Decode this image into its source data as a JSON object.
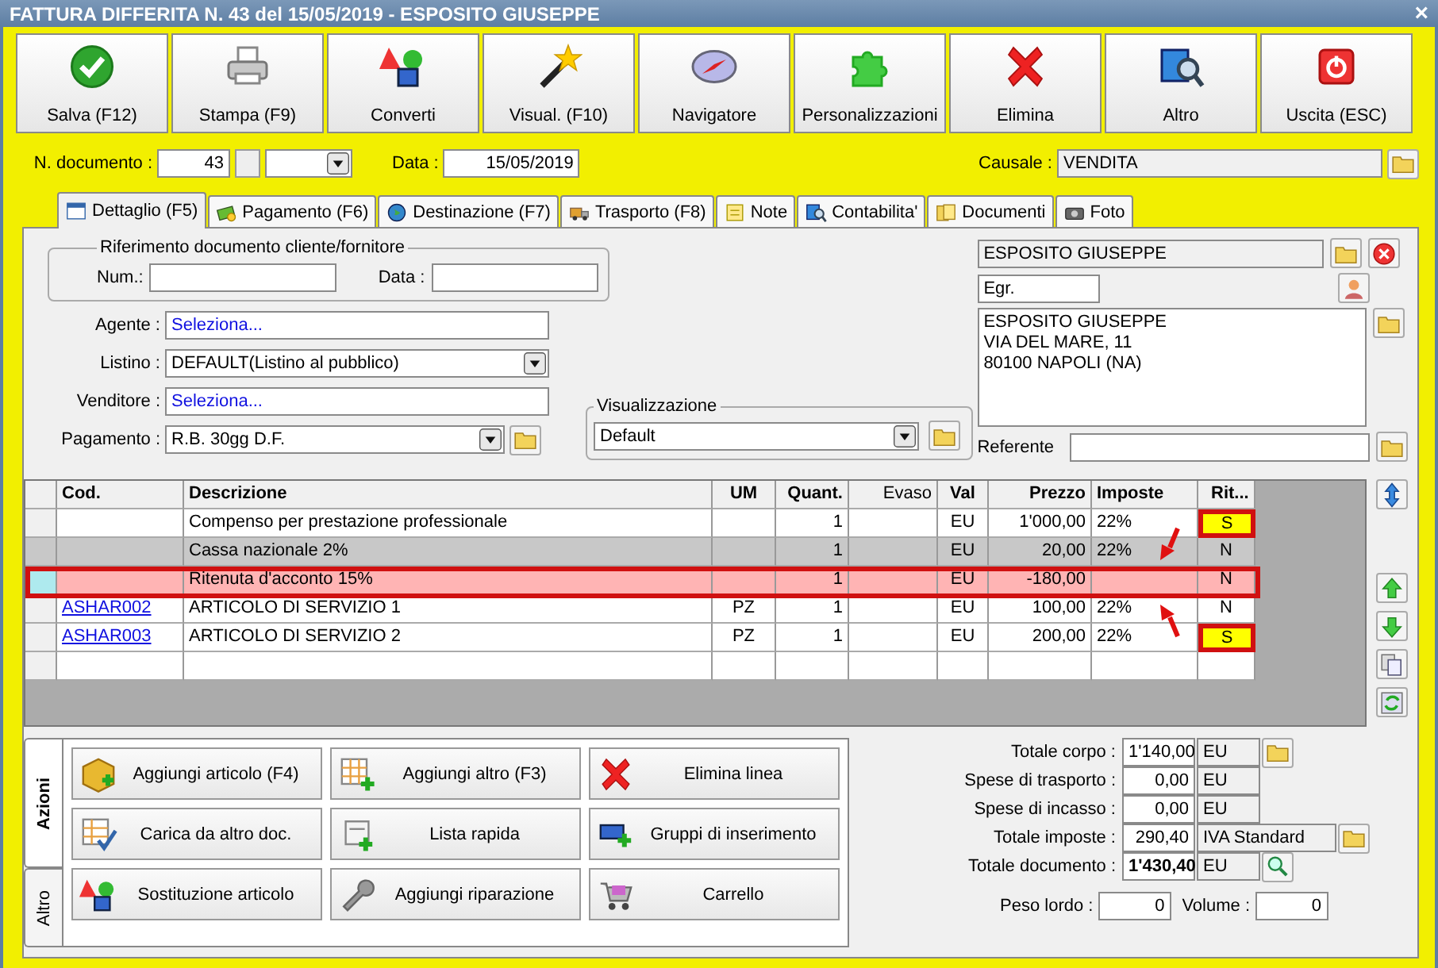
{
  "window": {
    "title": "FATTURA DIFFERITA N. 43 del 15/05/2019 - ESPOSITO GIUSEPPE",
    "close": "×"
  },
  "toolbar": [
    {
      "label": "Salva (F12)"
    },
    {
      "label": "Stampa (F9)"
    },
    {
      "label": "Converti"
    },
    {
      "label": "Visual. (F10)"
    },
    {
      "label": "Navigatore"
    },
    {
      "label": "Personalizzazioni"
    },
    {
      "label": "Elimina"
    },
    {
      "label": "Altro"
    },
    {
      "label": "Uscita (ESC)"
    }
  ],
  "header": {
    "doc_number_label": "N. documento :",
    "doc_number": "43",
    "date_label": "Data :",
    "date": "15/05/2019",
    "causale_label": "Causale :",
    "causale": "VENDITA"
  },
  "tabs": [
    {
      "label": "Dettaglio (F5)",
      "selected": true
    },
    {
      "label": "Pagamento (F6)",
      "selected": false
    },
    {
      "label": "Destinazione (F7)",
      "selected": false
    },
    {
      "label": "Trasporto (F8)",
      "selected": false
    },
    {
      "label": "Note",
      "selected": false
    },
    {
      "label": "Contabilita'",
      "selected": false
    },
    {
      "label": "Documenti",
      "selected": false
    },
    {
      "label": "Foto",
      "selected": false
    }
  ],
  "reference": {
    "legend": "Riferimento documento cliente/fornitore",
    "num_label": "Num.:",
    "date_label": "Data :"
  },
  "fields": [
    {
      "label": "Agente :",
      "value": "Seleziona...",
      "kind": "link"
    },
    {
      "label": "Listino :",
      "value": "DEFAULT(Listino al pubblico)",
      "kind": "select"
    },
    {
      "label": "Venditore :",
      "value": "Seleziona...",
      "kind": "link"
    },
    {
      "label": "Pagamento :",
      "value": "R.B. 30gg D.F.",
      "kind": "select_folder"
    }
  ],
  "view": {
    "legend": "Visualizzazione",
    "value": "Default"
  },
  "customer": {
    "name": "ESPOSITO GIUSEPPE",
    "title": "Egr.",
    "address": "ESPOSITO GIUSEPPE\nVIA DEL MARE, 11\n80100 NAPOLI (NA)",
    "referente_label": "Referente"
  },
  "table": {
    "columns": [
      "Cod.",
      "Descrizione",
      "UM",
      "Quant.",
      "Evaso",
      "Val",
      "Prezzo",
      "Imposte",
      "Rit..."
    ],
    "rows": [
      {
        "cells": [
          "",
          "Compenso per prestazione professionale",
          "",
          "1",
          "",
          "EU",
          "1'000,00",
          "22%",
          "S"
        ],
        "selected": false,
        "shaded": false,
        "marked": true
      },
      {
        "cells": [
          "",
          "Cassa nazionale 2%",
          "",
          "1",
          "",
          "EU",
          "20,00",
          "22%",
          "N"
        ],
        "selected": false,
        "shaded": true,
        "marked": false
      },
      {
        "cells": [
          "",
          "Ritenuta d'acconto 15%",
          "",
          "1",
          "",
          "EU",
          "-180,00",
          "",
          "N"
        ],
        "selected": true,
        "shaded": false,
        "marked": false
      },
      {
        "cells": [
          "ASHAR002",
          "ARTICOLO DI SERVIZIO 1",
          "PZ",
          "1",
          "",
          "EU",
          "100,00",
          "22%",
          "N"
        ],
        "selected": false,
        "shaded": false,
        "marked": false
      },
      {
        "cells": [
          "ASHAR003",
          "ARTICOLO DI SERVIZIO 2",
          "PZ",
          "1",
          "",
          "EU",
          "200,00",
          "22%",
          "S"
        ],
        "selected": false,
        "shaded": false,
        "marked": true
      }
    ]
  },
  "actions": {
    "tabs": [
      {
        "label": "Azioni",
        "selected": true
      },
      {
        "label": "Altro",
        "selected": false
      }
    ],
    "buttons": [
      {
        "label": "Aggiungi articolo (F4)"
      },
      {
        "label": "Aggiungi altro (F3)"
      },
      {
        "label": "Elimina linea"
      },
      {
        "label": "Carica da altro doc."
      },
      {
        "label": "Lista rapida"
      },
      {
        "label": "Gruppi di inserimento"
      },
      {
        "label": "Sostituzione articolo"
      },
      {
        "label": "Aggiungi riparazione"
      },
      {
        "label": "Carrello"
      }
    ]
  },
  "totals": [
    {
      "label": "Totale corpo :",
      "value": "1'140,00",
      "unit": "EU",
      "bold": false
    },
    {
      "label": "Spese di trasporto :",
      "value": "0,00",
      "unit": "EU",
      "bold": false
    },
    {
      "label": "Spese di incasso :",
      "value": "0,00",
      "unit": "EU",
      "bold": false
    },
    {
      "label": "Totale imposte :",
      "value": "290,40",
      "unit": "IVA Standard",
      "bold": false
    },
    {
      "label": "Totale documento :",
      "value": "1'430,40",
      "unit": "EU",
      "bold": true
    }
  ],
  "weight": {
    "gross_label": "Peso lordo :",
    "gross": "0",
    "volume_label": "Volume :",
    "volume": "0"
  }
}
